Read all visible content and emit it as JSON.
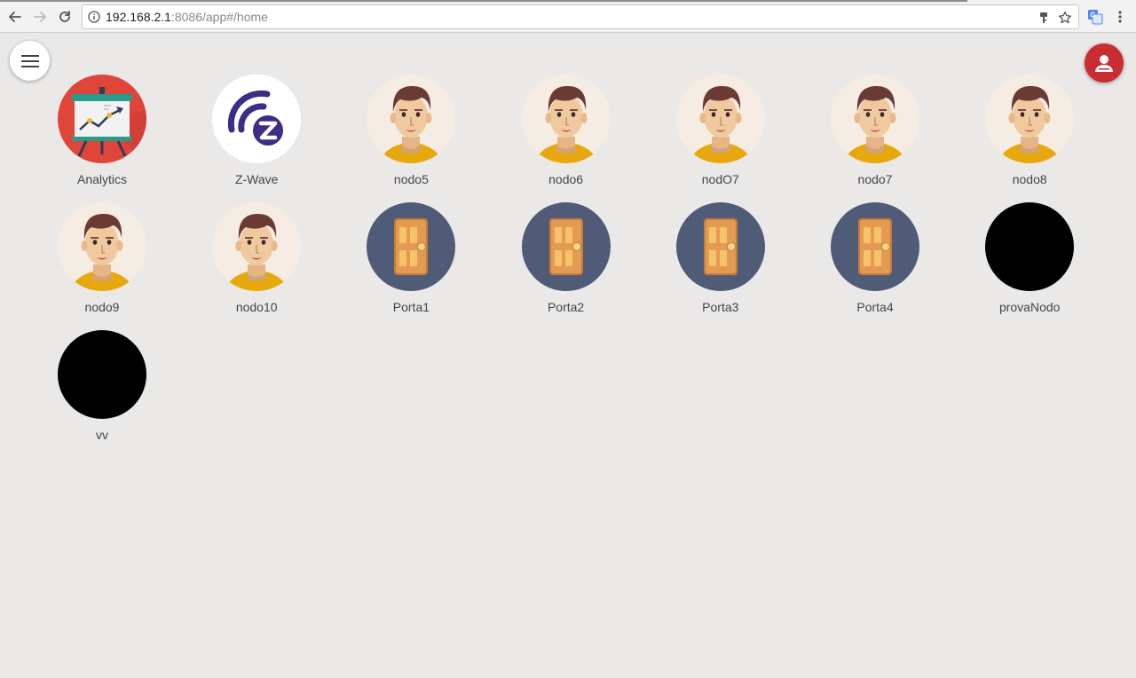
{
  "browser": {
    "url_host": "192.168.2.1",
    "url_rest": ":8086/app#/home"
  },
  "app": {
    "menu_icon": "hamburger-menu-icon",
    "user_icon": "user-account-icon"
  },
  "tiles": [
    {
      "label": "Analytics",
      "icon": "analytics-board-icon"
    },
    {
      "label": "Z-Wave",
      "icon": "zwave-logo-icon"
    },
    {
      "label": "nodo5",
      "icon": "person-avatar-icon"
    },
    {
      "label": "nodo6",
      "icon": "person-avatar-icon"
    },
    {
      "label": "nodO7",
      "icon": "person-avatar-icon"
    },
    {
      "label": "nodo7",
      "icon": "person-avatar-icon"
    },
    {
      "label": "nodo8",
      "icon": "person-avatar-icon"
    },
    {
      "label": "nodo9",
      "icon": "person-avatar-icon"
    },
    {
      "label": "nodo10",
      "icon": "person-avatar-icon"
    },
    {
      "label": "Porta1",
      "icon": "door-icon"
    },
    {
      "label": "Porta2",
      "icon": "door-icon"
    },
    {
      "label": "Porta3",
      "icon": "door-icon"
    },
    {
      "label": "Porta4",
      "icon": "door-icon"
    },
    {
      "label": "provaNodo",
      "icon": "empty-node-icon"
    },
    {
      "label": "vv",
      "icon": "empty-node-icon"
    }
  ],
  "colors": {
    "background": "#ebe9e8",
    "analytics_bg": "#e0453a",
    "door_bg": "#4f5b77",
    "door_panel": "#e39a52",
    "avatar_bg": "#f5ece3",
    "user_button": "#c92c32",
    "zwave_purple": "#3a2e85"
  }
}
